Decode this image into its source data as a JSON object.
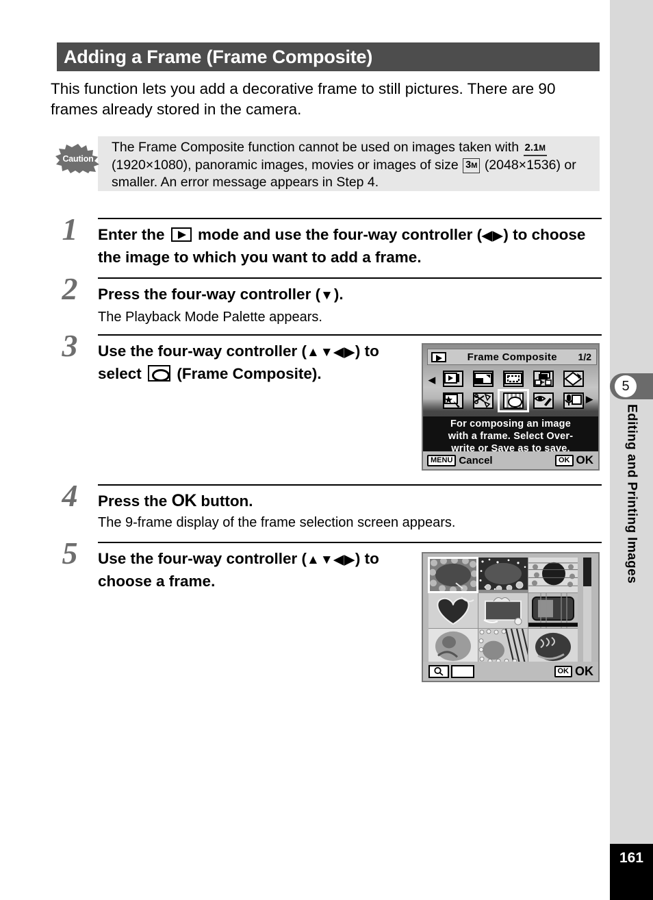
{
  "heading": {
    "title": "Adding a Frame (Frame Composite)"
  },
  "intro": "This function lets you add a decorative frame to still pictures. There are 90 frames already stored in the camera.",
  "caution": {
    "badge_label": "Caution",
    "line1_a": "The Frame Composite function cannot be used on images taken with",
    "badge_21m": "2.1",
    "badge_21m_unit": "M",
    "line2_a": "(1920×1080), panoramic images, movies or images of size",
    "badge_3m": "3",
    "badge_3m_unit": "M",
    "line3": "(2048×1536) or smaller. An error message appears in Step 4."
  },
  "steps": [
    {
      "num": "1",
      "title_a": "Enter the",
      "icon": "playback-mode-icon",
      "title_b": "mode and use the four-way controller (",
      "arrows": "◀▶",
      "title_c": ") to choose the image to which you want to add a frame.",
      "sub": ""
    },
    {
      "num": "2",
      "title_a": "Press the four-way controller (",
      "arrows": "▼",
      "title_c": ").",
      "sub": "The Playback Mode Palette appears."
    },
    {
      "num": "3",
      "title_a": "Use the four-way controller (",
      "arrows": "▲▼◀▶",
      "title_b": ") to select",
      "icon": "frame-composite-icon",
      "title_c": "(Frame Composite).",
      "sub": ""
    },
    {
      "num": "4",
      "title_a": "Press the",
      "ok": "OK",
      "title_c": "button.",
      "sub": "The 9-frame display of the frame selection screen appears."
    },
    {
      "num": "5",
      "title_a": "Use the four-way controller (",
      "arrows": "▲▼◀▶",
      "title_c": ") to choose a frame.",
      "sub": ""
    }
  ],
  "lcd_palette": {
    "mode_icon": "playback-icon",
    "title": "Frame Composite",
    "page_indicator": "1/2",
    "icons": [
      "slideshow-icon",
      "resize-icon",
      "cropping-icon",
      "image-copy-icon",
      "image-rotation-icon",
      "digital-filter-icon",
      "red-frame-cut-icon",
      "frame-composite-icon",
      "red-eye-compensation-icon",
      "voice-memo-icon"
    ],
    "selected_icon": "frame-composite-icon",
    "description_line1": "For composing an image",
    "description_line2": "with a frame. Select Over-",
    "description_line3": "write or Save as to save.",
    "menu_key": "MENU",
    "menu_label": "Cancel",
    "ok_key": "OK",
    "ok_label": "OK"
  },
  "lcd_frames": {
    "thumbnails": [
      "frame-roses",
      "frame-stars",
      "frame-cat-circle",
      "frame-heart",
      "frame-ribbon",
      "frame-tv",
      "frame-oval-soft",
      "frame-stripes",
      "frame-oval-knit"
    ],
    "selected_index": 0,
    "magnify_key": "magnify-icon",
    "ok_key": "OK",
    "ok_label": "OK"
  },
  "sidebar": {
    "chapter_number": "5",
    "chapter_title": "Editing and Printing Images",
    "page_number": "161"
  }
}
